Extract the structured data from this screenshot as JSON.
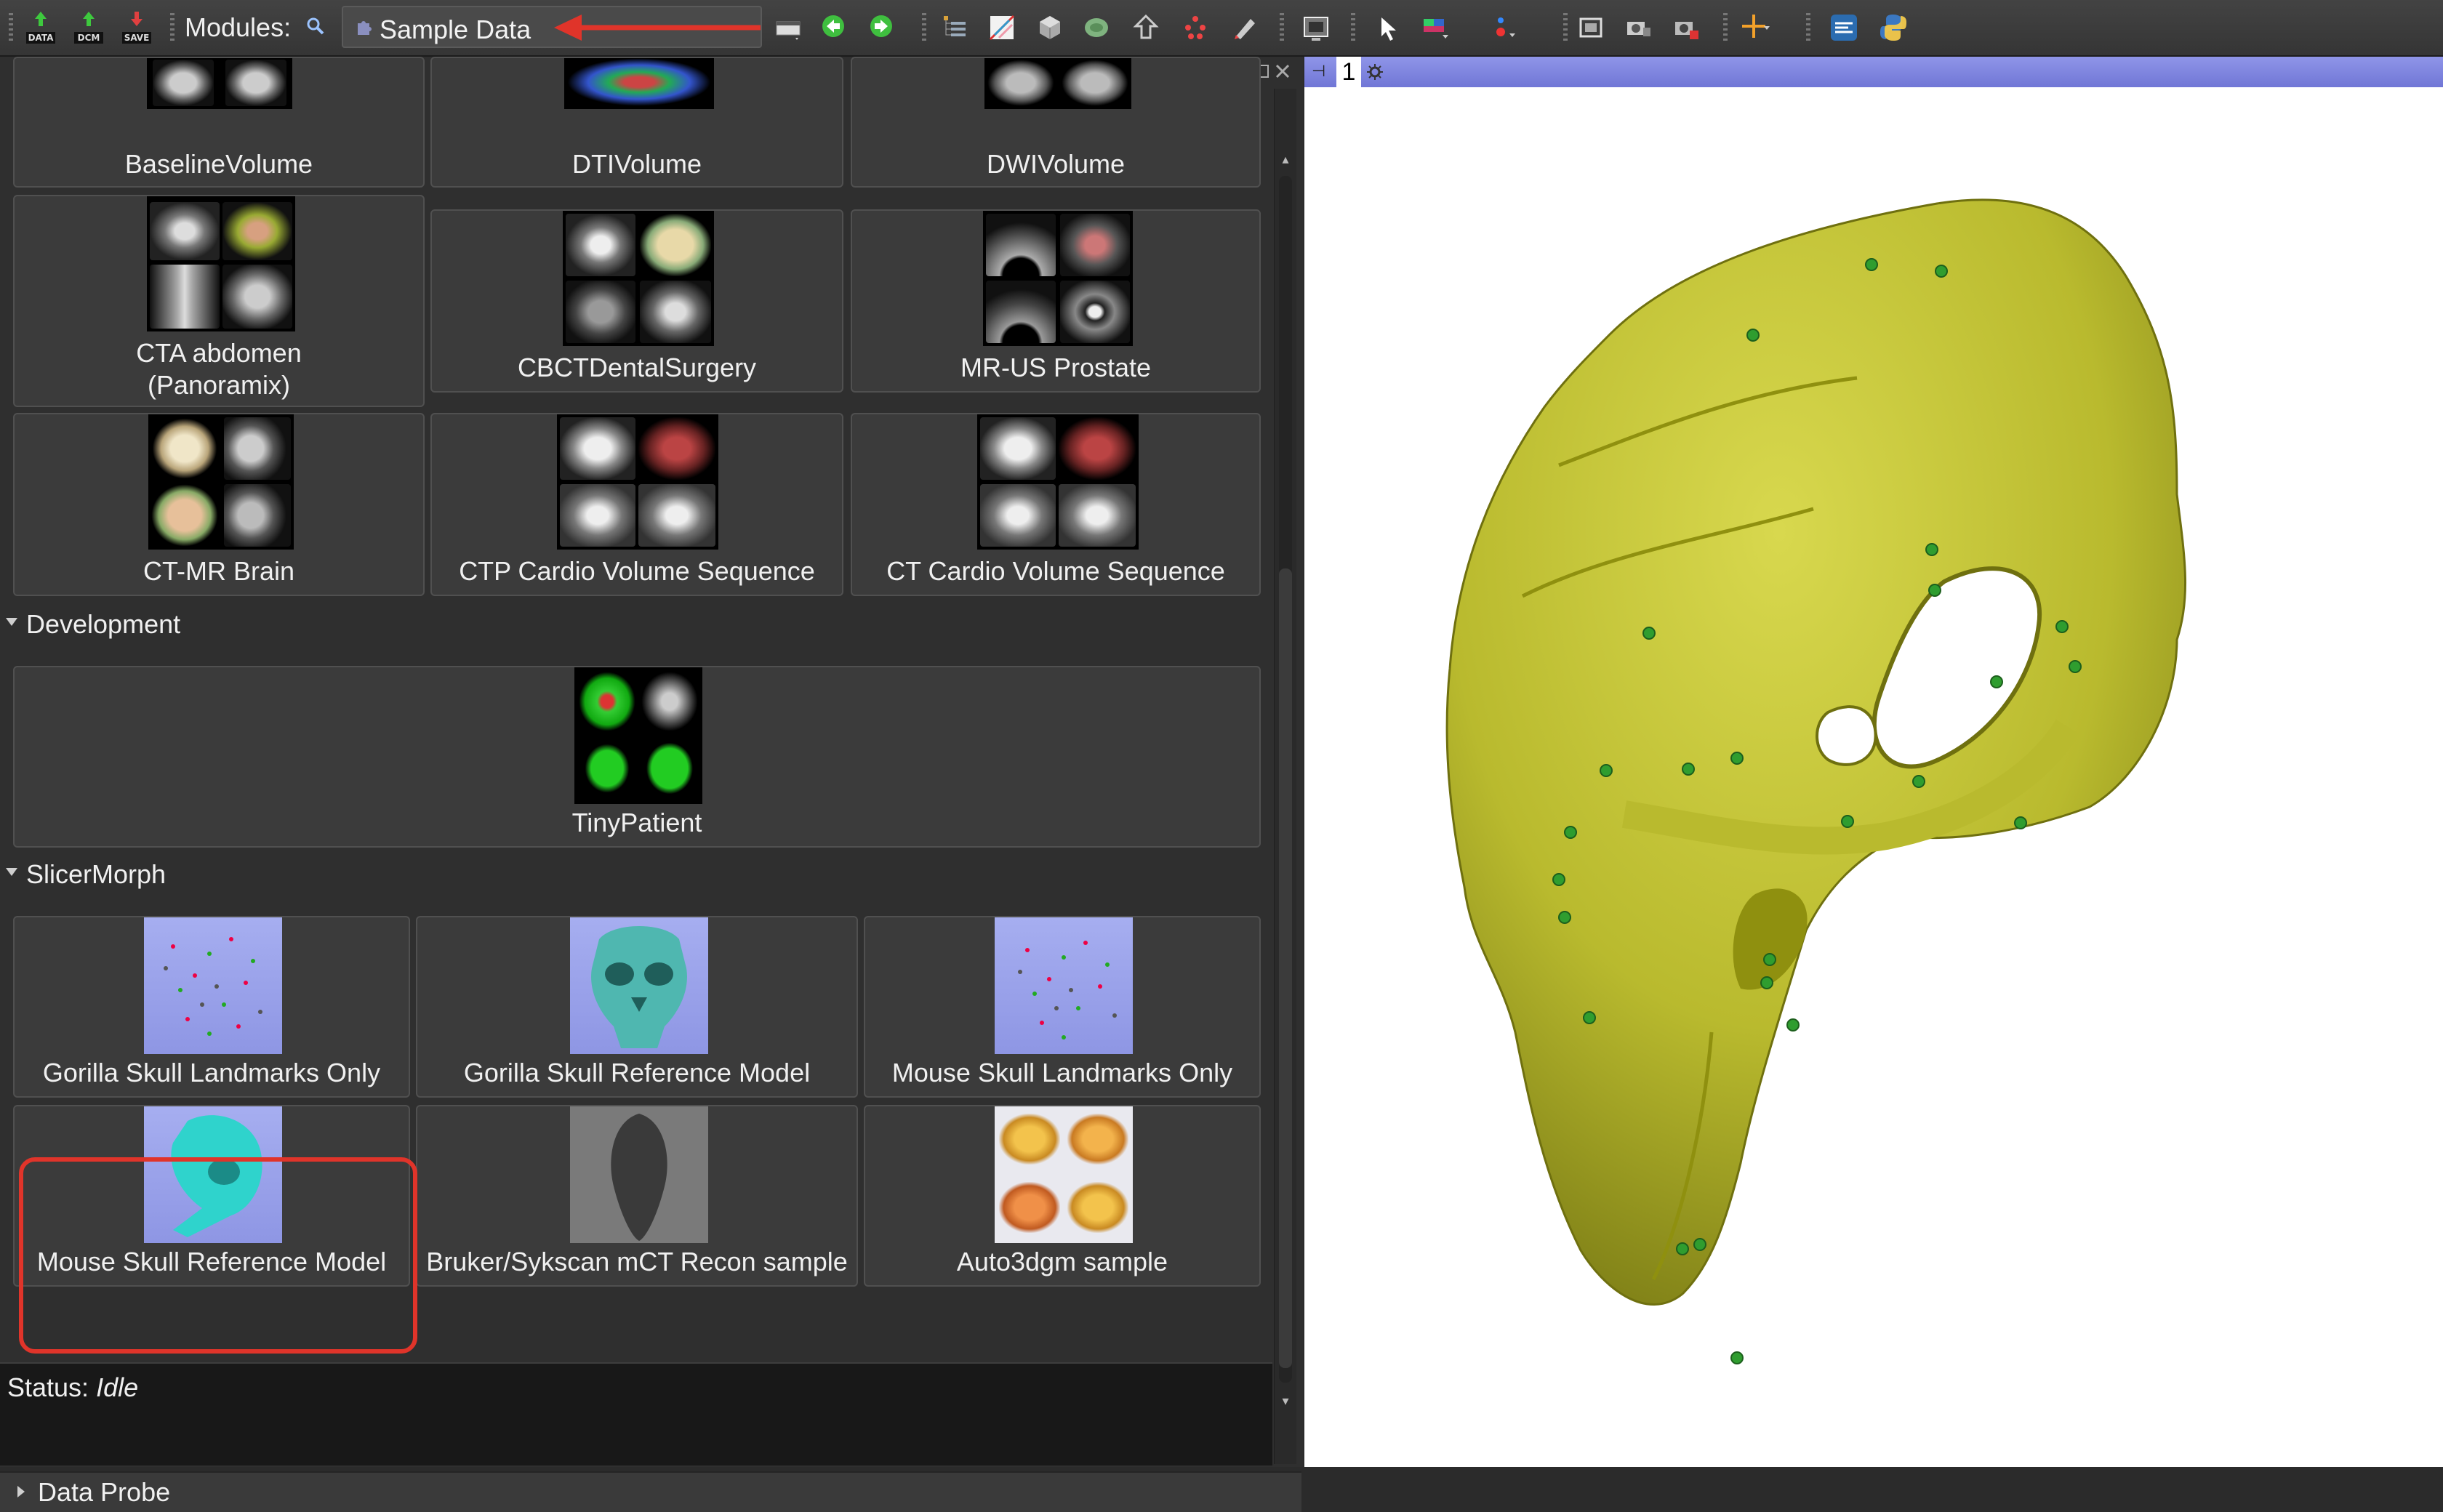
{
  "toolbar": {
    "io_buttons": [
      {
        "name": "data-button",
        "caption": "DATA"
      },
      {
        "name": "dcm-button",
        "caption": "DCM"
      },
      {
        "name": "save-button",
        "caption": "SAVE"
      }
    ],
    "modules_label": "Modules:",
    "current_module": "Sample Data",
    "icons": [
      "layout-icon",
      "back-icon",
      "forward-icon",
      "data-tree-icon",
      "volumes-icon",
      "models-icon",
      "segment-icon",
      "markups-icon",
      "transforms-icon",
      "editor-icon",
      "screenshot-icon",
      "select-icon",
      "window-level-icon",
      "fiducial-icon",
      "view-reset-icon",
      "camera-icon",
      "extension-icon",
      "python-icon"
    ]
  },
  "tiles_top": [
    {
      "label": "BaselineVolume"
    },
    {
      "label": "DTIVolume"
    },
    {
      "label": "DWIVolume"
    }
  ],
  "tiles_row2": [
    {
      "label": "CTA abdomen",
      "label2": "(Panoramix)"
    },
    {
      "label": "CBCTDentalSurgery"
    },
    {
      "label": "MR-US Prostate"
    }
  ],
  "tiles_row3": [
    {
      "label": "CT-MR Brain"
    },
    {
      "label": "CTP Cardio Volume Sequence"
    },
    {
      "label": "CT Cardio Volume Sequence"
    }
  ],
  "development": {
    "title": "Development",
    "tiles": [
      {
        "label": "TinyPatient"
      }
    ]
  },
  "slicermorph": {
    "title": "SlicerMorph",
    "tiles": [
      {
        "label": "Gorilla Skull Landmarks Only"
      },
      {
        "label": "Gorilla Skull Reference Model"
      },
      {
        "label": "Mouse Skull Landmarks Only"
      },
      {
        "label": "Mouse Skull Reference Model"
      },
      {
        "label": "Bruker/Sykscan mCT Recon sample"
      },
      {
        "label": "Auto3dgm sample"
      }
    ]
  },
  "status": {
    "prefix": "Status:",
    "value": "Idle"
  },
  "data_probe": "Data Probe",
  "view": {
    "number": "1",
    "model_color": "#c4c536",
    "landmark_color": "#2f9d2f"
  },
  "colors": {
    "view_bar": "#7d83e0",
    "highlight": "#e0342a",
    "arrow": "#e0342a"
  }
}
